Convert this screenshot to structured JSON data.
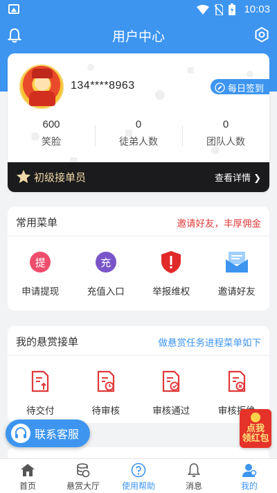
{
  "status_bar": {
    "time": "10:03"
  },
  "header": {
    "title": "用户中心"
  },
  "profile": {
    "phone": "134****8963",
    "sign_in_label": "每日签到",
    "stats": [
      {
        "value": "600",
        "label": "笑脸"
      },
      {
        "value": "0",
        "label": "徒弟人数"
      },
      {
        "value": "0",
        "label": "团队人数"
      }
    ],
    "level": {
      "name": "初级接单员",
      "detail_label": "查看详情"
    }
  },
  "common_menu": {
    "title": "常用菜单",
    "promo": "邀请好友，丰厚佣金",
    "items": [
      {
        "label": "申请提现",
        "icon": "提",
        "color": "#ee4d6c"
      },
      {
        "label": "充值入口",
        "icon": "充",
        "color": "#7a55c9"
      },
      {
        "label": "举报维权",
        "icon": "!",
        "color": "#e02a2a"
      },
      {
        "label": "邀请好友",
        "icon": "envelope",
        "color": "#3d95f0"
      }
    ]
  },
  "reward_orders": {
    "title": "我的悬赏接单",
    "hint": "做悬赏任务进程菜单如下",
    "items": [
      {
        "label": "待交付"
      },
      {
        "label": "待审核"
      },
      {
        "label": "审核通过"
      },
      {
        "label": "审核拒绝"
      }
    ]
  },
  "floating": {
    "service_label": "联系客服",
    "redpack_line1": "点我",
    "redpack_line2": "领红包"
  },
  "colors": {
    "accent": "#3d95f0",
    "red": "#e5332a",
    "gold": "#f0d9a8"
  },
  "tabs": [
    {
      "label": "首页",
      "icon": "home-icon"
    },
    {
      "label": "悬赏大厅",
      "icon": "coins-icon"
    },
    {
      "label": "使用帮助",
      "icon": "help-icon"
    },
    {
      "label": "消息",
      "icon": "bell-icon"
    },
    {
      "label": "我的",
      "icon": "user-icon"
    }
  ]
}
